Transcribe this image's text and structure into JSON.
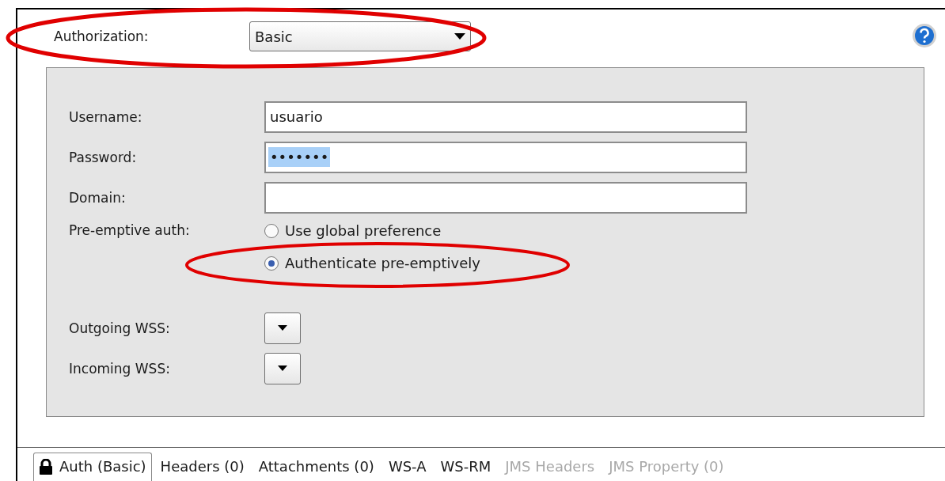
{
  "authorization": {
    "label": "Authorization:",
    "value": "Basic",
    "highlighted": true
  },
  "fields": [
    {
      "label": "Username:",
      "value": "usuario"
    },
    {
      "label": "Password:",
      "value": "•••••••",
      "selected_text": true
    },
    {
      "label": "Domain:"
    }
  ],
  "preemptive": {
    "label": "Pre-emptive auth:",
    "options": [
      {
        "label": "Use global preference",
        "selected": false
      },
      {
        "label": "Authenticate pre-emptively",
        "selected": true,
        "highlighted": true
      }
    ]
  },
  "wss": [
    {
      "label": "Outgoing WSS:"
    },
    {
      "label": "Incoming WSS:"
    }
  ],
  "tabs": [
    {
      "label": "Auth (Basic)",
      "selected": true,
      "disabled": false,
      "kind": "lock"
    },
    {
      "label": "Headers (0)",
      "selected": false,
      "disabled": false,
      "kind": "plain"
    },
    {
      "label": "Attachments (0)",
      "selected": false,
      "disabled": false,
      "kind": "plain"
    },
    {
      "label": "WS-A",
      "selected": false,
      "disabled": false,
      "kind": "plain"
    },
    {
      "label": "WS-RM",
      "selected": false,
      "disabled": false,
      "kind": "plain"
    },
    {
      "label": "JMS Headers",
      "selected": false,
      "disabled": true,
      "kind": "plain"
    },
    {
      "label": "JMS Property (0)",
      "selected": false,
      "disabled": true,
      "kind": "plain"
    }
  ]
}
